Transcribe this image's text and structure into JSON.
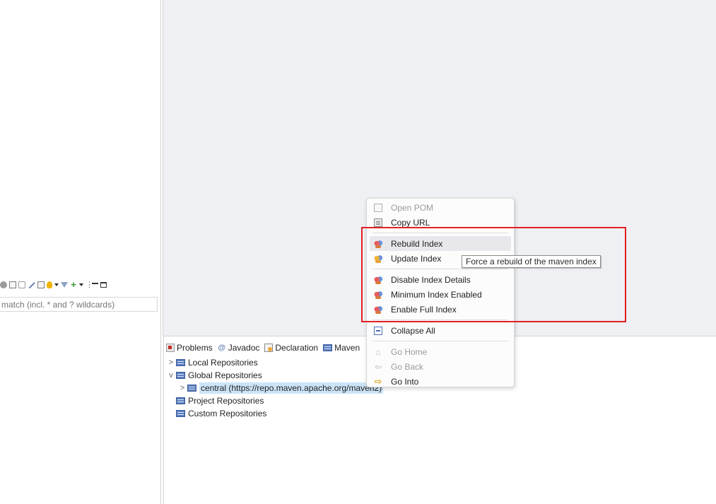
{
  "left_panel": {
    "filter_placeholder": "match (incl. * and ? wildcards)",
    "toolbar_icons": [
      "sync-icon",
      "collapse-icon",
      "hierarchy-icon",
      "pencil-icon",
      "view-icon",
      "bulb-icon",
      "dropdown-icon",
      "filter-icon",
      "add-icon",
      "dropdown-icon",
      "view-menu-icon",
      "minimize-icon",
      "maximize-icon"
    ]
  },
  "bottom_panel": {
    "tabs": [
      {
        "label": "Problems",
        "icon": "problems-icon"
      },
      {
        "label": "Javadoc",
        "icon": "javadoc-icon"
      },
      {
        "label": "Declaration",
        "icon": "declaration-icon"
      },
      {
        "label": "Maven",
        "icon": "maven-repositories-icon"
      }
    ],
    "tree": [
      {
        "label": "Local Repositories",
        "twisty": ">",
        "level": 0
      },
      {
        "label": "Global Repositories",
        "twisty": "v",
        "level": 0
      },
      {
        "label": "central (https://repo.maven.apache.org/maven2)",
        "twisty": ">",
        "level": 1,
        "selected": true
      },
      {
        "label": "Project Repositories",
        "twisty": "",
        "level": 0
      },
      {
        "label": "Custom Repositories",
        "twisty": "",
        "level": 0
      }
    ]
  },
  "context_menu": {
    "items": [
      {
        "label": "Open POM",
        "icon": "pom-file-icon",
        "enabled": false
      },
      {
        "label": "Copy URL",
        "icon": "copy-icon",
        "enabled": true
      },
      {
        "label": "Rebuild Index",
        "icon": "maven-index-icon",
        "enabled": true,
        "hovered": true
      },
      {
        "label": "Update Index",
        "icon": "maven-index-update-icon",
        "enabled": true
      },
      {
        "label": "Disable Index Details",
        "icon": "maven-index-icon",
        "enabled": true
      },
      {
        "label": "Minimum Index Enabled",
        "icon": "maven-index-icon",
        "enabled": true
      },
      {
        "label": "Enable Full Index",
        "icon": "maven-index-icon",
        "enabled": true
      },
      {
        "label": "Collapse All",
        "icon": "collapse-all-icon",
        "enabled": true
      },
      {
        "label": "Go Home",
        "icon": "home-icon",
        "enabled": false
      },
      {
        "label": "Go Back",
        "icon": "back-arrow-icon",
        "enabled": false
      },
      {
        "label": "Go Into",
        "icon": "go-into-arrow-icon",
        "enabled": true
      }
    ]
  },
  "tooltip": {
    "text": "Force a rebuild of the maven index"
  },
  "colors": {
    "highlight": "#e31e24",
    "selection": "#cce4f7",
    "editor_bg": "#eef0f3"
  }
}
